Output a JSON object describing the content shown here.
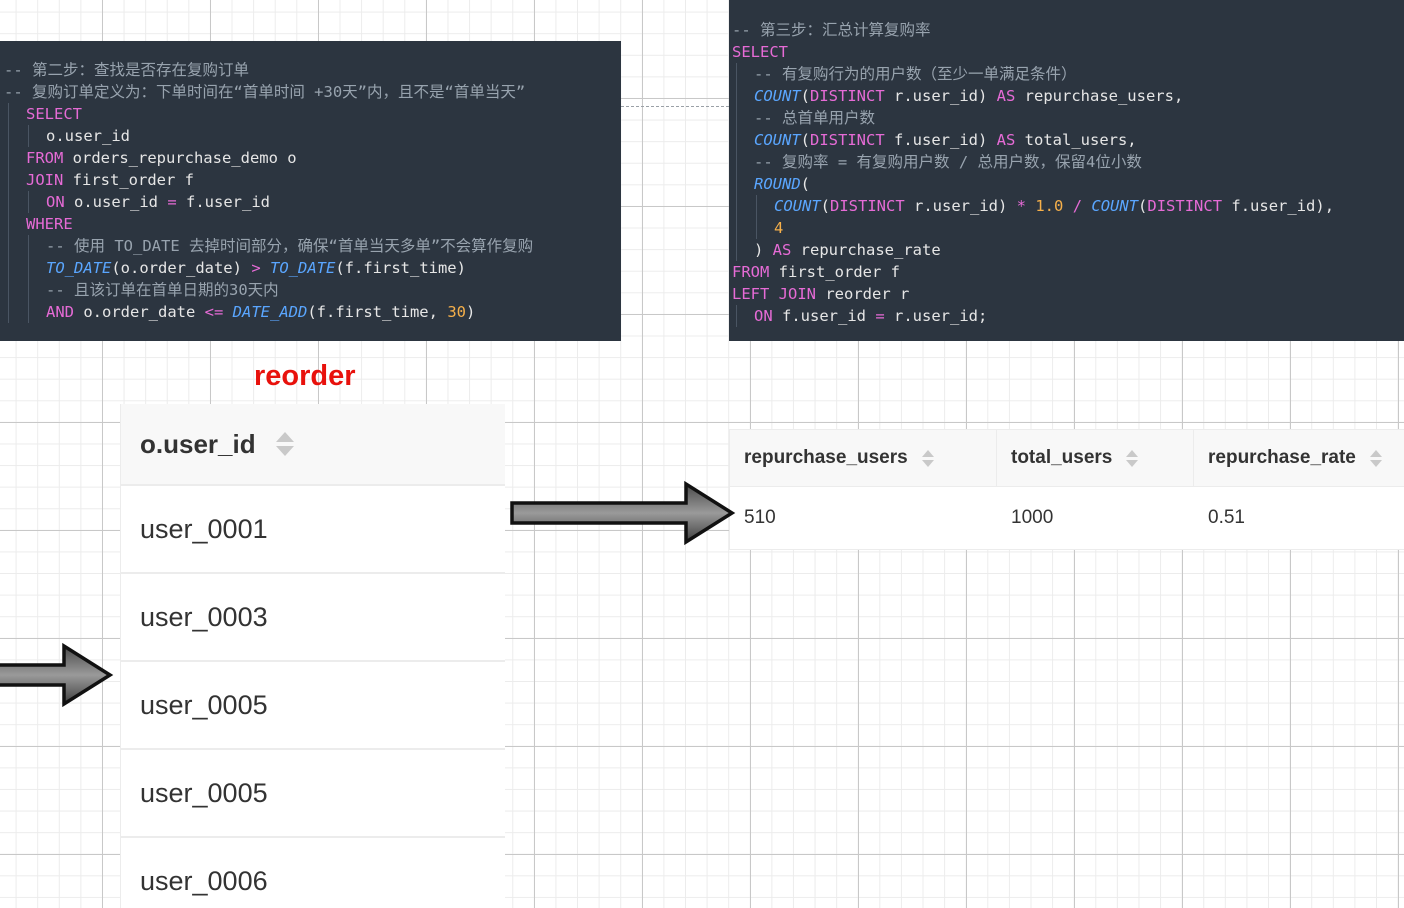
{
  "code_step2": {
    "lines": [
      "-- 第二步：查找是否存在复购订单",
      "-- 复购订单定义为：下单时间在“首单时间 +30天”内，且不是“首单当天”",
      "SELECT",
      "o.user_id",
      "FROM",
      " orders_repurchase_demo o",
      "JOIN",
      " first_order f",
      "ON",
      " o.user_id ",
      "=",
      " f.user_id",
      "WHERE",
      "-- 使用 TO_DATE 去掉时间部分，确保“首单当天多单”不会算作复购",
      "TO_DATE",
      "(o.order_date) ",
      ">",
      " ",
      "TO_DATE",
      "(f.first_time)",
      "-- 且该订单在首单日期的30天内",
      "AND",
      " o.order_date ",
      "<=",
      " ",
      "DATE_ADD",
      "(f.first_time, ",
      "30",
      ")"
    ]
  },
  "code_step3": {
    "lines": [
      "-- 第三步：汇总计算复购率",
      "SELECT",
      "-- 有复购行为的用户数（至少一单满足条件）",
      "COUNT",
      "(",
      "DISTINCT",
      " r.user_id) ",
      "AS",
      " repurchase_users,",
      "-- 总首单用户数",
      "COUNT",
      "(",
      "DISTINCT",
      " f.user_id) ",
      "AS",
      " total_users,",
      "-- 复购率 = 有复购用户数 / 总用户数，保留4位小数",
      "ROUND",
      "(",
      "COUNT",
      "(",
      "DISTINCT",
      " r.user_id) ",
      "*",
      " ",
      "1.0",
      " ",
      "/",
      " ",
      "COUNT",
      "(",
      "DISTINCT",
      " f.user_id),",
      "4",
      ") ",
      "AS",
      " repurchase_rate",
      "FROM",
      " first_order f",
      "LEFT JOIN",
      " reorder r",
      "ON",
      " f.user_id ",
      "=",
      " r.user_id;"
    ]
  },
  "reorder_label": "reorder",
  "reorder_table": {
    "header": "o.user_id",
    "rows": [
      "user_0001",
      "user_0003",
      "user_0005",
      "user_0005",
      "user_0006"
    ]
  },
  "result_table": {
    "headers": [
      "repurchase_users",
      "total_users",
      "repurchase_rate"
    ],
    "row": [
      "510",
      "1000",
      "0.51"
    ]
  },
  "icons": {
    "sort": "sort-icon",
    "arrow": "arrow-right-icon"
  },
  "colors": {
    "code_bg": "#2c3540",
    "keyword": "#e66bd6",
    "function": "#5aa6ff",
    "number": "#f6b04a",
    "comment": "#98a3ae",
    "reorder_title": "#e8110c"
  }
}
